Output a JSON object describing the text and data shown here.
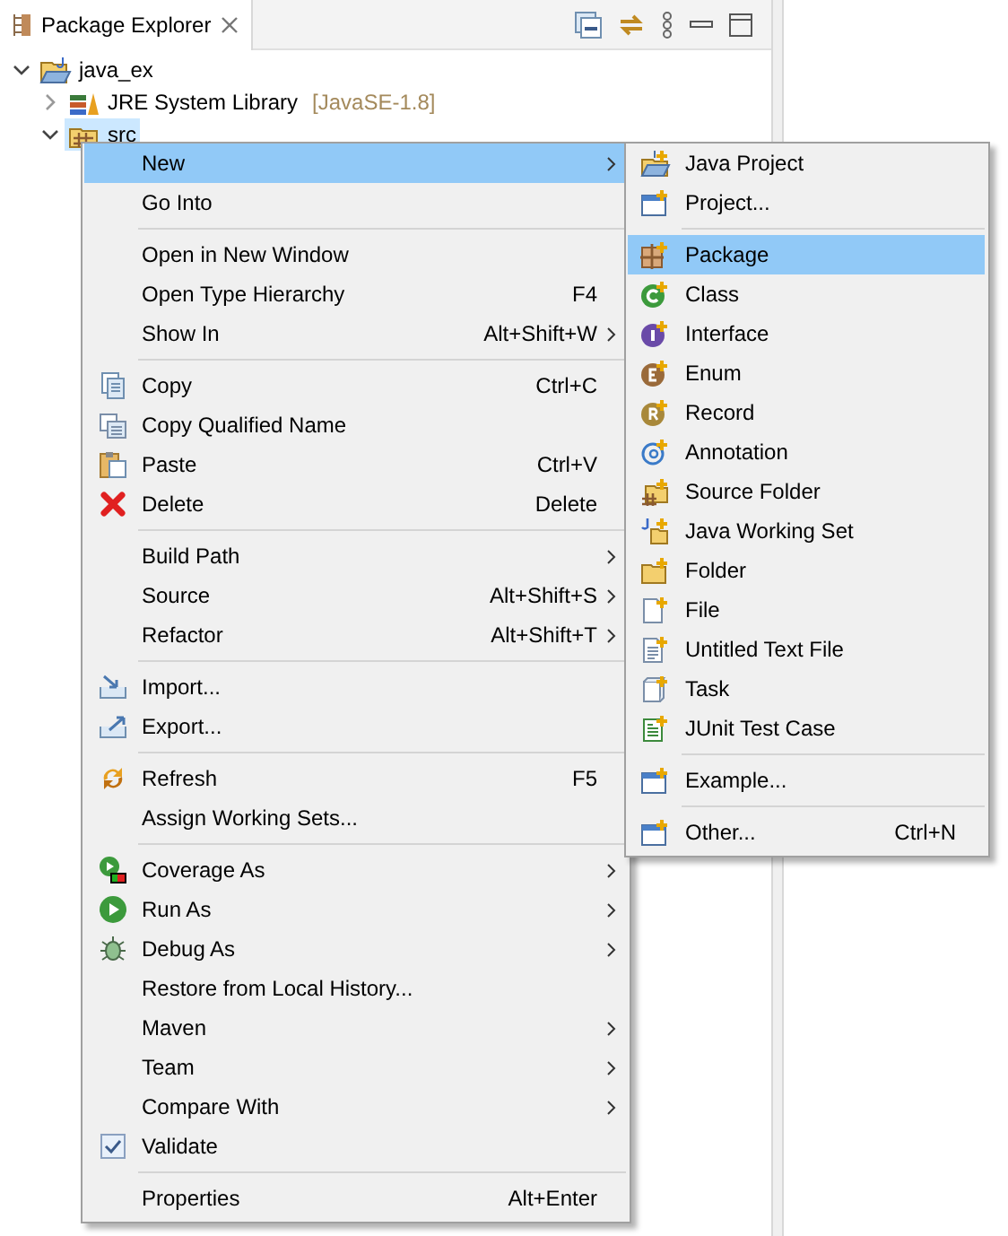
{
  "view": {
    "tab_title": "Package Explorer"
  },
  "tree": [
    {
      "label": "java_ex",
      "expanded": true,
      "selected": false,
      "children": [
        {
          "label": "JRE System Library",
          "decoration": "[JavaSE-1.8]",
          "expanded": false,
          "selected": false
        },
        {
          "label": "src",
          "expanded": true,
          "selected": true
        }
      ]
    }
  ],
  "context_menu": {
    "groups": [
      [
        {
          "label": "New",
          "has_submenu": true,
          "selected": true
        },
        {
          "label": "Go Into",
          "has_submenu": false,
          "selected": false
        }
      ],
      [
        {
          "label": "Open in New Window",
          "has_submenu": false,
          "selected": false
        },
        {
          "label": "Open Type Hierarchy",
          "shortcut": "F4",
          "has_submenu": false,
          "selected": false
        },
        {
          "label": "Show In",
          "shortcut": "Alt+Shift+W",
          "has_submenu": true,
          "selected": false
        }
      ],
      [
        {
          "label": "Copy",
          "shortcut": "Ctrl+C",
          "has_submenu": false,
          "selected": false
        },
        {
          "label": "Copy Qualified Name",
          "has_submenu": false,
          "selected": false
        },
        {
          "label": "Paste",
          "shortcut": "Ctrl+V",
          "has_submenu": false,
          "selected": false
        },
        {
          "label": "Delete",
          "shortcut": "Delete",
          "has_submenu": false,
          "selected": false
        }
      ],
      [
        {
          "label": "Build Path",
          "has_submenu": true,
          "selected": false
        },
        {
          "label": "Source",
          "shortcut": "Alt+Shift+S",
          "has_submenu": true,
          "selected": false
        },
        {
          "label": "Refactor",
          "shortcut": "Alt+Shift+T",
          "has_submenu": true,
          "selected": false
        }
      ],
      [
        {
          "label": "Import...",
          "has_submenu": false,
          "selected": false
        },
        {
          "label": "Export...",
          "has_submenu": false,
          "selected": false
        }
      ],
      [
        {
          "label": "Refresh",
          "shortcut": "F5",
          "has_submenu": false,
          "selected": false
        },
        {
          "label": "Assign Working Sets...",
          "has_submenu": false,
          "selected": false
        }
      ],
      [
        {
          "label": "Coverage As",
          "has_submenu": true,
          "selected": false
        },
        {
          "label": "Run As",
          "has_submenu": true,
          "selected": false
        },
        {
          "label": "Debug As",
          "has_submenu": true,
          "selected": false
        },
        {
          "label": "Restore from Local History...",
          "has_submenu": false,
          "selected": false
        },
        {
          "label": "Maven",
          "has_submenu": true,
          "selected": false
        },
        {
          "label": "Team",
          "has_submenu": true,
          "selected": false
        },
        {
          "label": "Compare With",
          "has_submenu": true,
          "selected": false
        },
        {
          "label": "Validate",
          "kind": "check",
          "checked": true,
          "has_submenu": false,
          "selected": false
        }
      ],
      [
        {
          "label": "Properties",
          "shortcut": "Alt+Enter",
          "has_submenu": false,
          "selected": false
        }
      ]
    ]
  },
  "new_submenu": {
    "groups": [
      [
        {
          "label": "Java Project",
          "selected": false
        },
        {
          "label": "Project...",
          "selected": false
        }
      ],
      [
        {
          "label": "Package",
          "selected": true
        },
        {
          "label": "Class",
          "selected": false
        },
        {
          "label": "Interface",
          "selected": false
        },
        {
          "label": "Enum",
          "selected": false
        },
        {
          "label": "Record",
          "selected": false
        },
        {
          "label": "Annotation",
          "selected": false
        },
        {
          "label": "Source Folder",
          "selected": false
        },
        {
          "label": "Java Working Set",
          "selected": false
        },
        {
          "label": "Folder",
          "selected": false
        },
        {
          "label": "File",
          "selected": false
        },
        {
          "label": "Untitled Text File",
          "selected": false
        },
        {
          "label": "Task",
          "selected": false
        },
        {
          "label": "JUnit Test Case",
          "selected": false
        }
      ],
      [
        {
          "label": "Example...",
          "selected": false
        }
      ],
      [
        {
          "label": "Other...",
          "shortcut": "Ctrl+N",
          "selected": false
        }
      ]
    ]
  }
}
